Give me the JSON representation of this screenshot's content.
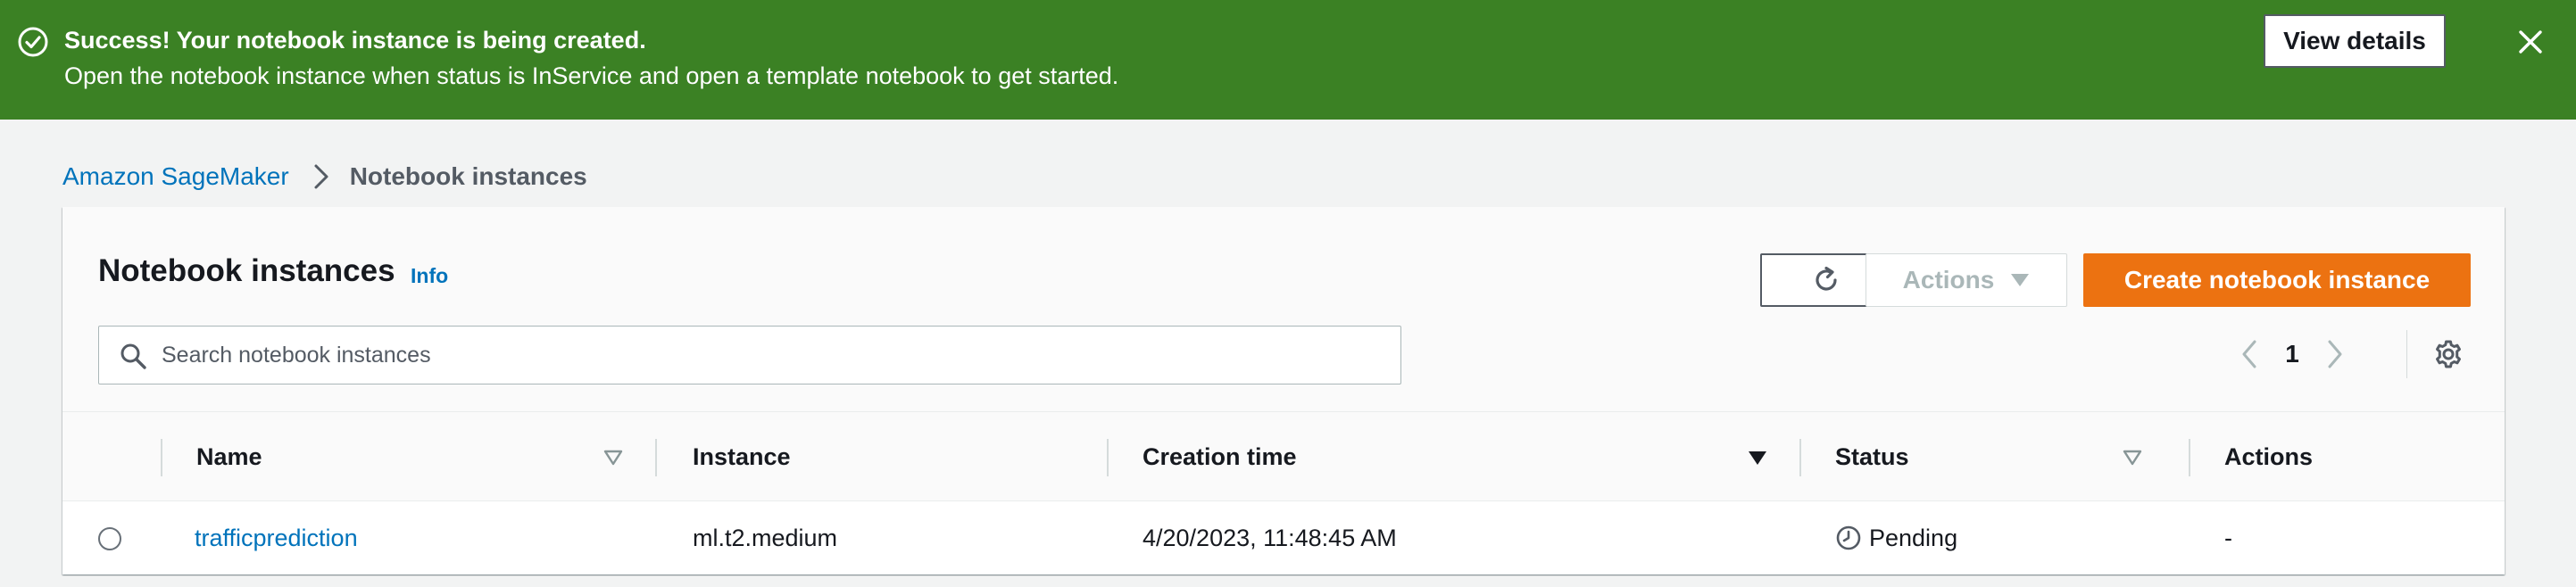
{
  "flash": {
    "title": "Success! Your notebook instance is being created.",
    "message": "Open the notebook instance when status is InService and open a template notebook to get started.",
    "view_details_label": "View details",
    "icons": {
      "status": "check-circle-icon",
      "dismiss": "close-icon"
    },
    "color": "#3b8124"
  },
  "breadcrumb": {
    "items": [
      {
        "label": "Amazon SageMaker",
        "link": true
      },
      {
        "label": "Notebook instances",
        "link": false
      }
    ]
  },
  "panel": {
    "title": "Notebook instances",
    "info_label": "Info",
    "actions_label": "Actions",
    "create_label": "Create notebook instance",
    "search": {
      "placeholder": "Search notebook instances",
      "value": ""
    },
    "pagination": {
      "current_page": "1"
    }
  },
  "table": {
    "columns": [
      {
        "label": "Name",
        "sort": "sortable"
      },
      {
        "label": "Instance",
        "sort": "none"
      },
      {
        "label": "Creation time",
        "sort": "sorted-descending"
      },
      {
        "label": "Status",
        "sort": "sortable"
      },
      {
        "label": "Actions",
        "sort": "none"
      }
    ],
    "rows": [
      {
        "name": "trafficprediction",
        "instance": "ml.t2.medium",
        "creation_time": "4/20/2023, 11:48:45 AM",
        "status": "Pending",
        "status_icon": "clock-icon",
        "actions": "-"
      }
    ]
  },
  "colors": {
    "accent_link": "#0073bb",
    "primary_button": "#ec7211",
    "success": "#3b8124"
  }
}
